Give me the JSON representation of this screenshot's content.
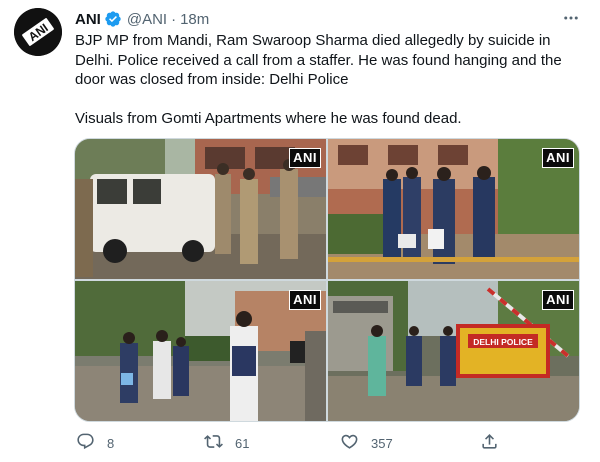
{
  "tweet": {
    "author": {
      "name": "ANI",
      "handle": "@ANI",
      "verified": true,
      "avatar_text": "ANI"
    },
    "separator": "·",
    "time": "18m",
    "more_icon": "more-horizontal-icon",
    "text": [
      "BJP MP from Mandi, Ram Swaroop Sharma died allegedly by suicide in Delhi. Police received a call from a staffer. He was found hanging and the door was closed from inside: Delhi Police",
      "Visuals from Gomti Apartments where he was found dead."
    ],
    "media": [
      {
        "watermark": "ANI",
        "description": "police-jeep-and-officers"
      },
      {
        "watermark": "ANI",
        "description": "forensic-team-carrying-boxes"
      },
      {
        "watermark": "ANI",
        "description": "forensic-team-walking-in-compound"
      },
      {
        "watermark": "ANI",
        "description": "guard-post-with-delhi-police-barricade",
        "barricade_text": "DELHI POLICE"
      }
    ],
    "actions": {
      "reply": {
        "icon": "reply-icon",
        "count": "8"
      },
      "retweet": {
        "icon": "retweet-icon",
        "count": "61"
      },
      "like": {
        "icon": "heart-icon",
        "count": "357"
      },
      "share": {
        "icon": "share-icon"
      }
    }
  },
  "colors": {
    "text_primary": "#0f1419",
    "text_secondary": "#536471",
    "verified_blue": "#1d9bf0",
    "border": "#cfd9de"
  }
}
